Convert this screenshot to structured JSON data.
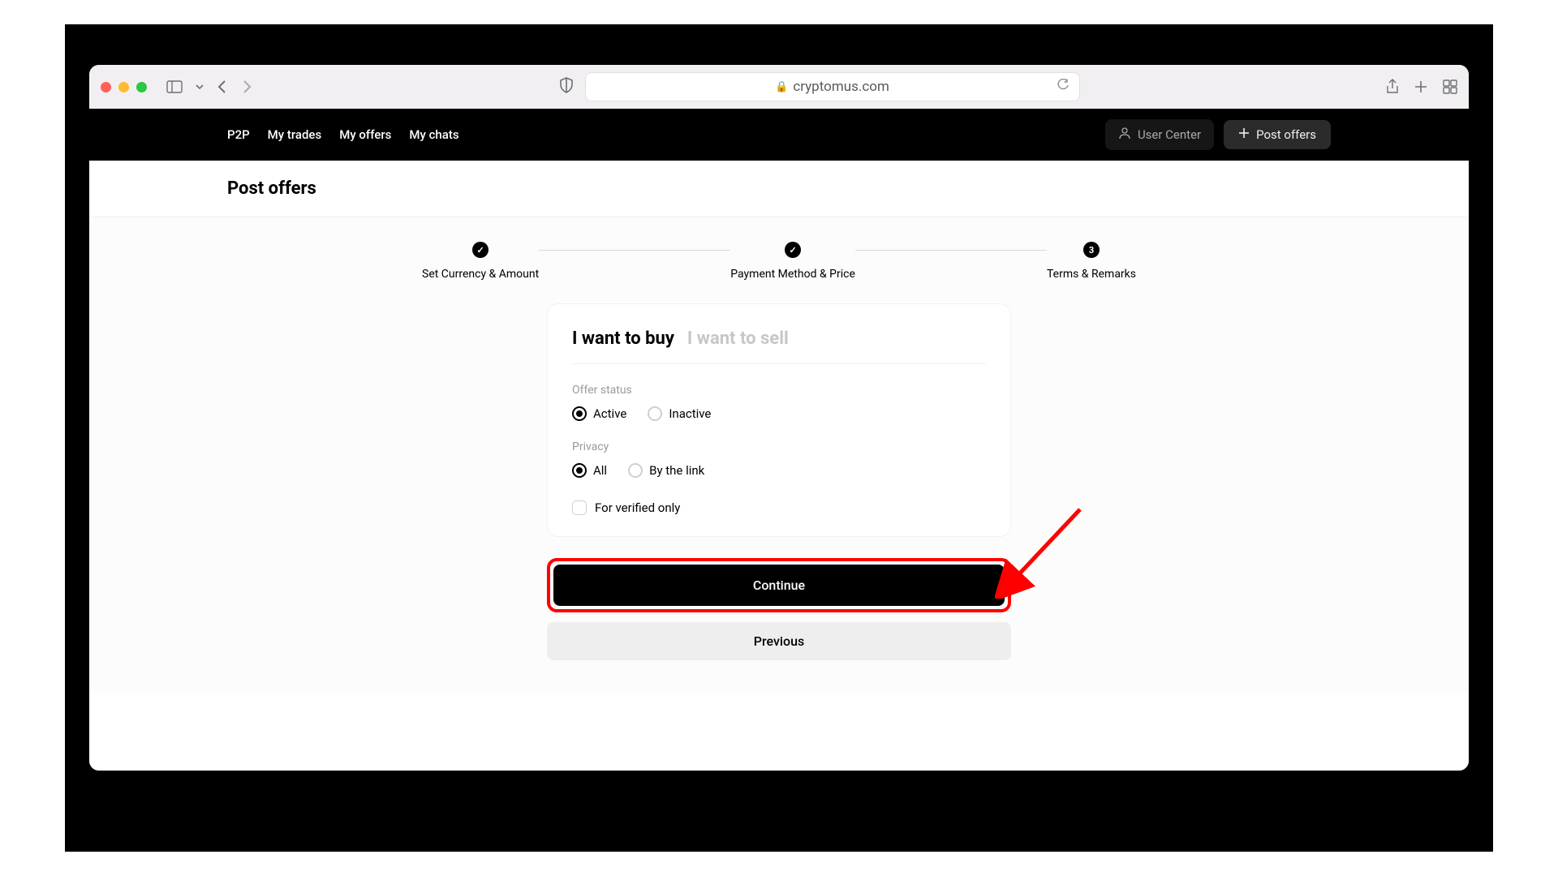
{
  "browser": {
    "url": "cryptomus.com"
  },
  "nav": {
    "links": [
      "P2P",
      "My trades",
      "My offers",
      "My chats"
    ],
    "user_center": "User Center",
    "post_offers": "Post offers"
  },
  "page": {
    "title": "Post offers"
  },
  "stepper": {
    "step1": {
      "label": "Set Currency & Amount",
      "icon": "✓"
    },
    "step2": {
      "label": "Payment Method & Price",
      "icon": "✓"
    },
    "step3": {
      "label": "Terms & Remarks",
      "icon": "3"
    }
  },
  "card": {
    "tab_buy": "I want to buy",
    "tab_sell": "I want to sell",
    "offer_status_label": "Offer status",
    "status_active": "Active",
    "status_inactive": "Inactive",
    "privacy_label": "Privacy",
    "privacy_all": "All",
    "privacy_link": "By the link",
    "verified_only": "For verified only"
  },
  "buttons": {
    "continue": "Continue",
    "previous": "Previous"
  }
}
